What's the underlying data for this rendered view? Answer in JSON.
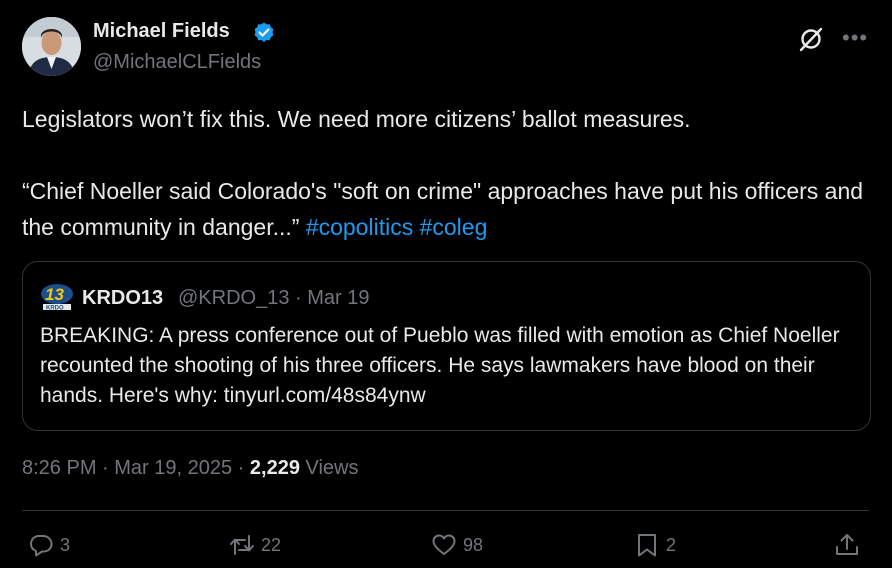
{
  "author": {
    "name": "Michael Fields",
    "handle": "@MichaelCLFields"
  },
  "tweet": {
    "line1": "Legislators won’t fix this. We need more citizens’ ballot measures.",
    "line2": "“Chief Noeller said Colorado's \"soft on crime\" approaches have put his officers and the community in danger...”",
    "hashtags": [
      "#copolitics",
      "#coleg"
    ]
  },
  "quote": {
    "name": "KRDO13",
    "handle": "@KRDO_13 · Mar 19",
    "logo_text": "13",
    "text": "BREAKING: A press conference out of Pueblo was filled with emotion as Chief Noeller recounted the shooting of his three officers. He says lawmakers have blood on their hands. Here's why: tinyurl.com/48s84ynw"
  },
  "meta": {
    "time": "8:26 PM · Mar 19, 2025 · ",
    "views_count": "2,229",
    "views_label": " Views"
  },
  "actions": {
    "replies": "3",
    "reposts": "22",
    "likes": "98",
    "bookmarks": "2"
  },
  "colors": {
    "background": "#000000",
    "accent": "#1d9bf0",
    "muted": "#71767b"
  }
}
